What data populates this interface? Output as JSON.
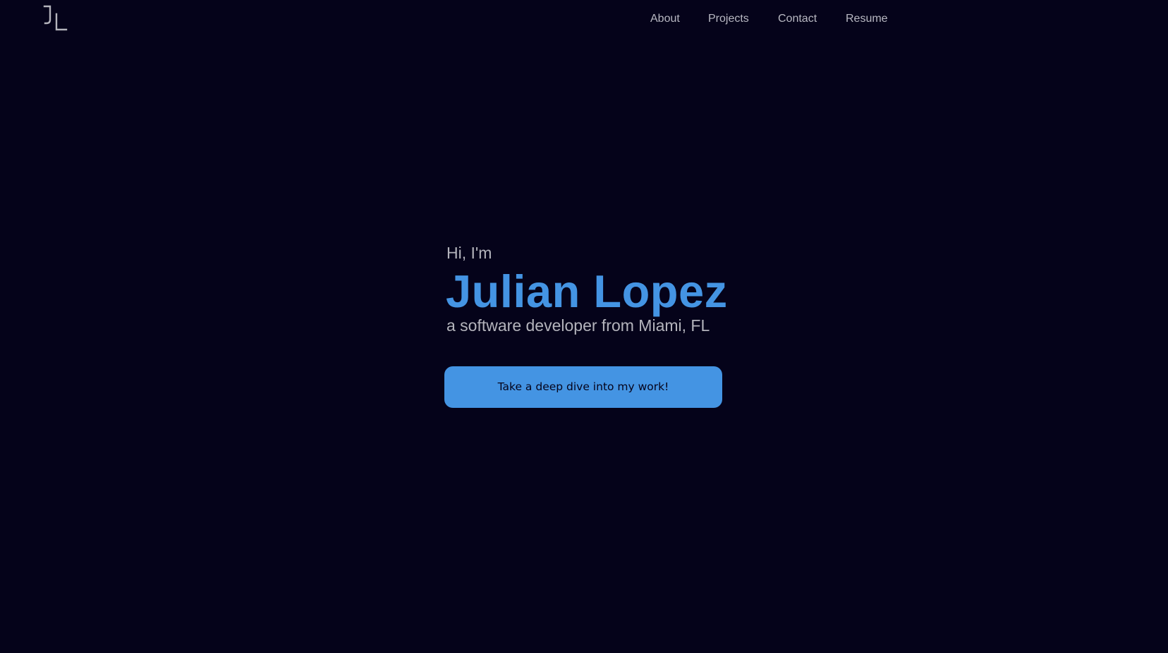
{
  "brand": {
    "logo_text": "JL",
    "logo_icon": "jl-monogram-logo"
  },
  "nav": {
    "items": [
      {
        "label": "About"
      },
      {
        "label": "Projects"
      },
      {
        "label": "Contact"
      },
      {
        "label": "Resume"
      }
    ]
  },
  "hero": {
    "greeting": "Hi, I'm",
    "name": "Julian Lopez",
    "tagline": "a software developer from Miami, FL",
    "cta_label": "Take a deep dive into my work!"
  },
  "colors": {
    "background": "#05031a",
    "accent": "#4494e3",
    "muted_text": "#b4b4bc"
  }
}
